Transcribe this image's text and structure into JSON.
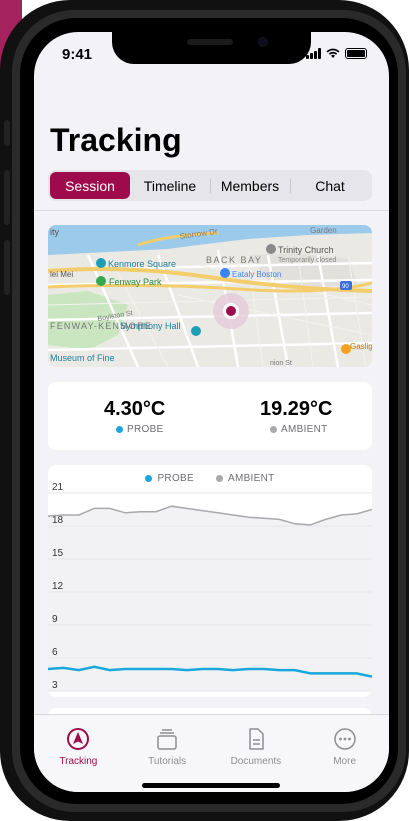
{
  "status_bar": {
    "time": "9:41"
  },
  "page": {
    "title": "Tracking"
  },
  "segments": [
    {
      "label": "Session",
      "active": true
    },
    {
      "label": "Timeline",
      "active": false
    },
    {
      "label": "Members",
      "active": false
    },
    {
      "label": "Chat",
      "active": false
    }
  ],
  "map": {
    "labels": {
      "storrow": "Storrow Dr",
      "garden": "Garden",
      "trinity": "Trinity Church",
      "trinity_sub": "Temporarily closed",
      "kenmore": "Kenmore Square",
      "back_bay": "BACK BAY",
      "eataly": "Eataly Boston",
      "fenway_park": "Fenway Park",
      "lei_mei": "lei Mei",
      "boylston": "Boylston St",
      "fenway_kenmore": "FENWAY-KENMORE",
      "symphony": "Symphony Hall",
      "museum": "Museum of Fine",
      "gaslight": "Gaslig Brass",
      "union_park": "nion St",
      "interstate": "90",
      "city": "ity"
    }
  },
  "readings": {
    "probe": {
      "value": "4.30°C",
      "label": "PROBE",
      "color": "#19a7dd"
    },
    "ambient": {
      "value": "19.29°C",
      "label": "AMBIENT",
      "color": "#a8a8ad"
    }
  },
  "chart_data": {
    "type": "line",
    "ylim": [
      3,
      21
    ],
    "y_ticks": [
      "21",
      "18",
      "15",
      "12",
      "9",
      "6",
      "3"
    ],
    "series": [
      {
        "name": "AMBIENT",
        "color": "#a8a8ad",
        "values": [
          18.9,
          19.0,
          19.0,
          19.6,
          19.6,
          19.2,
          19.3,
          19.3,
          19.8,
          19.6,
          19.4,
          19.2,
          19.0,
          18.8,
          18.7,
          18.6,
          18.2,
          18.1,
          18.6,
          19.0,
          19.1,
          19.5
        ]
      },
      {
        "name": "PROBE",
        "color": "#19a7dd",
        "values": [
          5.0,
          5.1,
          4.9,
          5.2,
          4.9,
          5.0,
          5.0,
          5.0,
          5.0,
          4.9,
          5.0,
          5.0,
          4.9,
          5.0,
          5.0,
          4.9,
          4.9,
          4.6,
          4.6,
          4.6,
          4.6,
          4.3
        ]
      }
    ]
  },
  "tabs": [
    {
      "label": "Tracking",
      "icon": "compass-icon",
      "active": true
    },
    {
      "label": "Tutorials",
      "icon": "tray-stack-icon",
      "active": false
    },
    {
      "label": "Documents",
      "icon": "document-icon",
      "active": false
    },
    {
      "label": "More",
      "icon": "ellipsis-circle-icon",
      "active": false
    }
  ],
  "colors": {
    "accent": "#9e0b4c",
    "probe": "#19a7dd",
    "ambient": "#a8a8ad"
  }
}
